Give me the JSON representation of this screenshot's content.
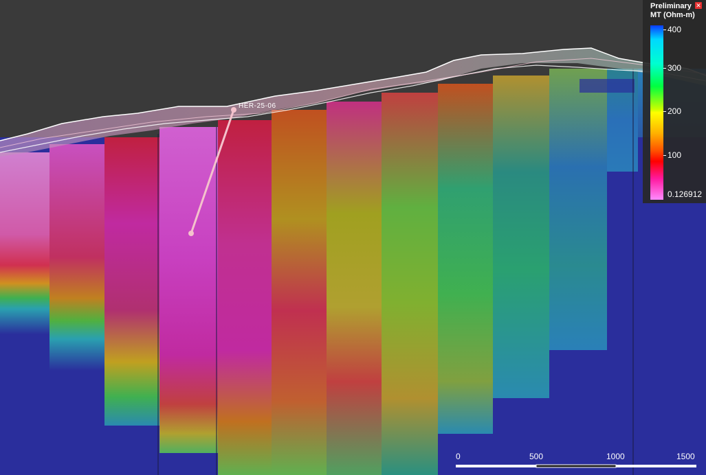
{
  "drillhole": {
    "label": "HER-25-06"
  },
  "legend": {
    "title_line1": "Preliminary",
    "title_line2": "MT (Ohm-m)",
    "close_icon": "close-icon",
    "ticks": [
      "400",
      "300",
      "200",
      "100",
      "0.126912"
    ]
  },
  "scale_bar": {
    "labels": [
      "0",
      "500",
      "1000",
      "1500"
    ]
  },
  "colors": {
    "background": "#3a3a3a",
    "model_base": "#2a2e9c",
    "drillhole": "#f4c2cc"
  }
}
